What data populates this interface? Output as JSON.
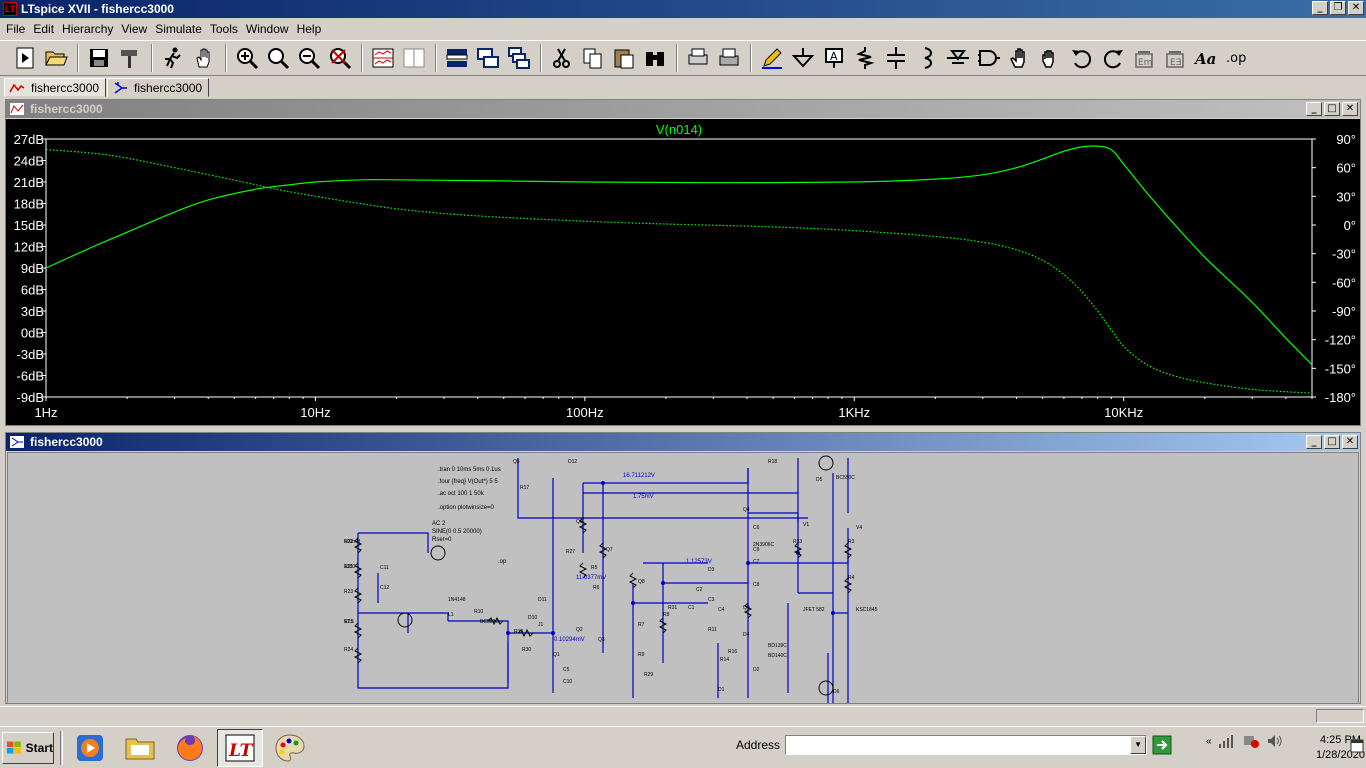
{
  "window": {
    "title": "LTspice XVII - fishercc3000",
    "app_icon_text": "LT"
  },
  "menu": [
    "File",
    "Edit",
    "Hierarchy",
    "View",
    "Simulate",
    "Tools",
    "Window",
    "Help"
  ],
  "tabs": [
    {
      "label": "fishercc3000",
      "icon": "waveform-icon",
      "active": true
    },
    {
      "label": "fishercc3000",
      "icon": "schematic-icon",
      "active": false
    }
  ],
  "plot_window": {
    "title": "fishercc3000",
    "trace_label": "V(n014)",
    "colors": {
      "trace": "#00ff00",
      "axes": "#ffffff",
      "background": "#000000"
    }
  },
  "schematic_window": {
    "title": "fishercc3000",
    "directives": [
      ".tran 0 10ms 5ms 0.1us",
      ".four {freq} V(Out*) 5 5",
      ".ac oct 100 1 50k",
      ".option plotwinsize=0",
      ".op"
    ],
    "source_label": "AC 2",
    "source_sine": "SINE(0 0.5 20000)",
    "source_rser": "Rser=0",
    "node_voltages": [
      "16.711212V",
      "1.75mV",
      "1.12573V",
      "11.0377mV",
      "0.10294mV"
    ],
    "components": [
      "R22",
      "R21",
      "R25",
      "R24",
      "R23",
      "C11",
      "C12",
      "L1",
      "R10",
      "R13",
      "J1",
      "Q1",
      "Q2",
      "Q3",
      "Q4",
      "Q5",
      "Q6",
      "Q7",
      "Q8",
      "Q9",
      "R33",
      "R3",
      "R4",
      "R5",
      "R6",
      "R7",
      "R8",
      "R9",
      "R11",
      "R14",
      "R16",
      "R17",
      "R18",
      "R27",
      "R29",
      "R30",
      "R31",
      "C1",
      "C2",
      "C3",
      "C4",
      "C5",
      "C6",
      "C7",
      "C8",
      "C9",
      "C10",
      "D1",
      "D2",
      "D3",
      "D4",
      "D5",
      "D6",
      "D10",
      "D11",
      "D12",
      "V1",
      "V4",
      "JFET 582",
      "KSC1845",
      "2N3906C",
      "BD139C",
      "BD140C",
      "1N4148",
      "BC559C",
      "BC550C",
      "500mH",
      "1350",
      "17.5"
    ]
  },
  "chart_data": {
    "type": "line",
    "trace_label": "V(n014)",
    "x_scale": "log",
    "xlim": [
      1,
      50000
    ],
    "x_ticks": [
      "1Hz",
      "10Hz",
      "100Hz",
      "1KHz",
      "10KHz"
    ],
    "y_left_ticks": [
      "27dB",
      "24dB",
      "21dB",
      "18dB",
      "15dB",
      "12dB",
      "9dB",
      "6dB",
      "3dB",
      "0dB",
      "-3dB",
      "-6dB",
      "-9dB"
    ],
    "y_left_lim": [
      -9,
      27
    ],
    "y_right_ticks": [
      "90°",
      "60°",
      "30°",
      "0°",
      "-30°",
      "-60°",
      "-90°",
      "-120°",
      "-150°",
      "-180°"
    ],
    "y_right_lim": [
      -180,
      90
    ],
    "grid": false,
    "series": [
      {
        "name": "magnitude",
        "style": "solid",
        "x": [
          1,
          1.5,
          2,
          3,
          4,
          6,
          8,
          10,
          15,
          20,
          40,
          100,
          300,
          1000,
          2000,
          3000,
          4000,
          5000,
          6000,
          7000,
          8000,
          9000,
          10000,
          12000,
          15000,
          20000,
          30000,
          40000,
          50000
        ],
        "y": [
          9,
          12,
          14,
          16.8,
          18.5,
          20,
          20.6,
          21,
          21.3,
          21.3,
          21.2,
          21,
          20.9,
          21,
          21.4,
          22,
          23,
          24.2,
          25.3,
          25.9,
          26,
          25.5,
          23.5,
          19.8,
          15.6,
          10.5,
          4.2,
          -0.8,
          -4.5
        ]
      },
      {
        "name": "phase",
        "style": "dotted",
        "x": [
          1,
          1.5,
          2,
          3,
          5,
          7,
          10,
          15,
          20,
          30,
          50,
          100,
          200,
          500,
          1000,
          2000,
          3000,
          4000,
          5000,
          6000,
          7000,
          8000,
          9000,
          10000,
          12000,
          15000,
          20000,
          30000,
          50000
        ],
        "y": [
          79,
          75,
          70,
          60,
          47,
          38,
          30,
          22,
          17,
          12,
          8,
          4,
          1,
          -2,
          -6,
          -12,
          -18,
          -26,
          -37,
          -52,
          -70,
          -90,
          -110,
          -127,
          -145,
          -157,
          -165,
          -172,
          -176
        ]
      }
    ]
  },
  "address_bar": {
    "label": "Address",
    "value": ""
  },
  "clock": {
    "time": "4:25 PM",
    "date": "1/28/2020"
  },
  "taskbar": {
    "start_label": "Start"
  }
}
